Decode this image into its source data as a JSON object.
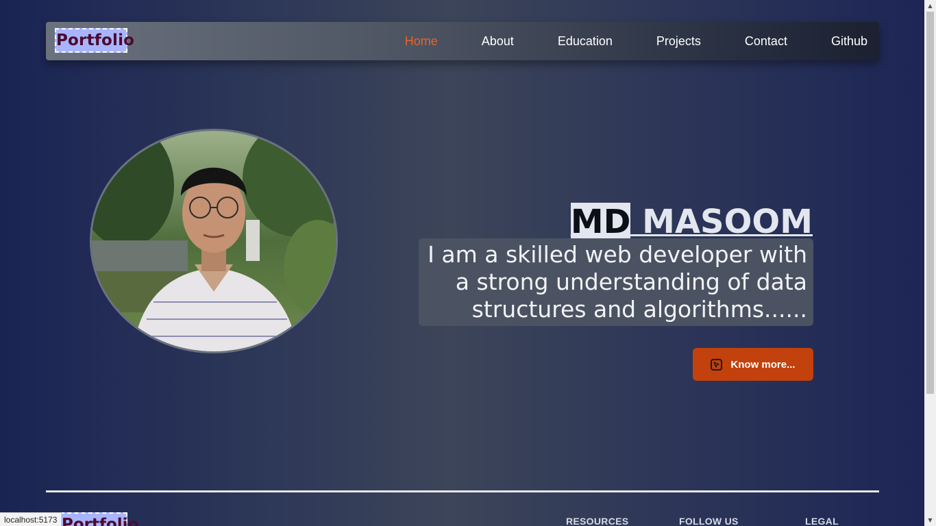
{
  "navbar": {
    "brand": "Portfolio",
    "links": [
      "Home",
      "About",
      "Education",
      "Projects",
      "Contact",
      "Github"
    ],
    "active_index": 0
  },
  "hero": {
    "name_first": "MD",
    "name_rest": " MASOOM",
    "description": "I am a skilled web developer with a strong understanding of data structures and algorithms......",
    "button_label": "Know more..."
  },
  "footer": {
    "brand": "Portfolio",
    "columns": [
      "RESOURCES",
      "FOLLOW US",
      "LEGAL"
    ]
  },
  "status_bar": {
    "url": "localhost:5173"
  },
  "colors": {
    "accent": "#c2410c",
    "active_link": "#e8642a",
    "brand_bg": "#a9b4ff",
    "brand_text": "#4a0b2e"
  }
}
